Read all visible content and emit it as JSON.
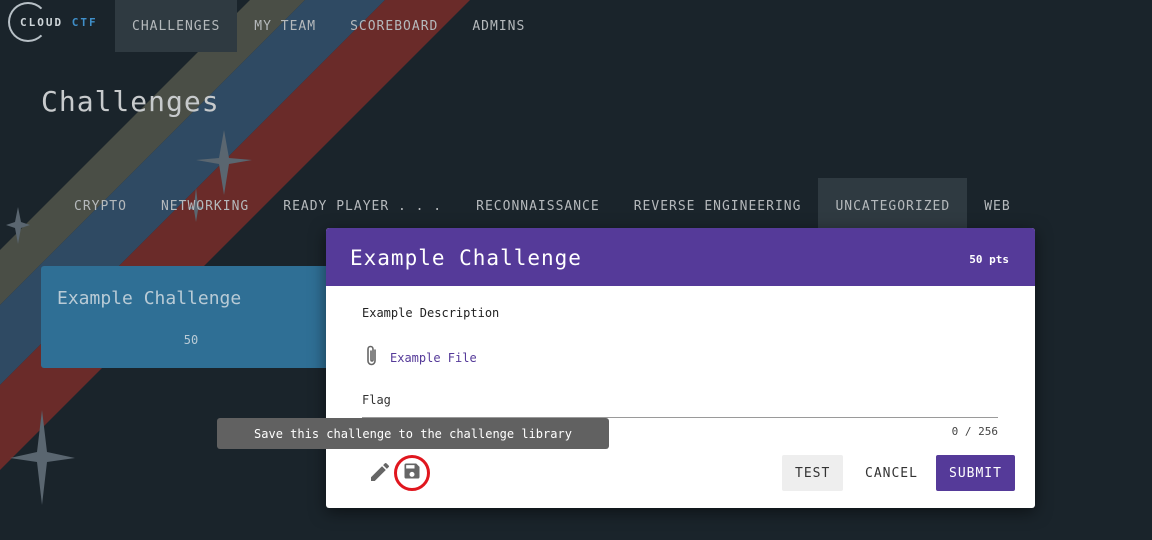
{
  "navbar": {
    "logo_text_a": "CLOUD",
    "logo_text_b": "CTF",
    "items": [
      {
        "label": "CHALLENGES",
        "active": true
      },
      {
        "label": "MY TEAM",
        "active": false
      },
      {
        "label": "SCOREBOARD",
        "active": false
      },
      {
        "label": "ADMINS",
        "active": false
      }
    ]
  },
  "page": {
    "title": "Challenges"
  },
  "tabs": [
    {
      "label": "CRYPTO",
      "active": false
    },
    {
      "label": "NETWORKING",
      "active": false
    },
    {
      "label": "READY PLAYER . . .",
      "active": false
    },
    {
      "label": "RECONNAISSANCE",
      "active": false
    },
    {
      "label": "REVERSE ENGINEERING",
      "active": false
    },
    {
      "label": "UNCATEGORIZED",
      "active": true
    },
    {
      "label": "WEB",
      "active": false
    }
  ],
  "card": {
    "title": "Example Challenge",
    "points": "50"
  },
  "modal": {
    "title": "Example Challenge",
    "points": "50 pts",
    "description": "Example Description",
    "file_label": "Example File",
    "flag_label": "Flag",
    "flag_value": "",
    "counter": "0 / 256",
    "test_label": "TEST",
    "cancel_label": "CANCEL",
    "submit_label": "SUBMIT"
  },
  "tooltip": {
    "text": "Save this challenge to the challenge library"
  },
  "colors": {
    "background": "#1a242b",
    "accent": "#553a99",
    "card": "#2f6f95",
    "highlight_ring": "#e0161e"
  },
  "icons": {
    "attachment": "paperclip-icon",
    "edit": "pencil-icon",
    "save": "floppy-disk-icon"
  }
}
